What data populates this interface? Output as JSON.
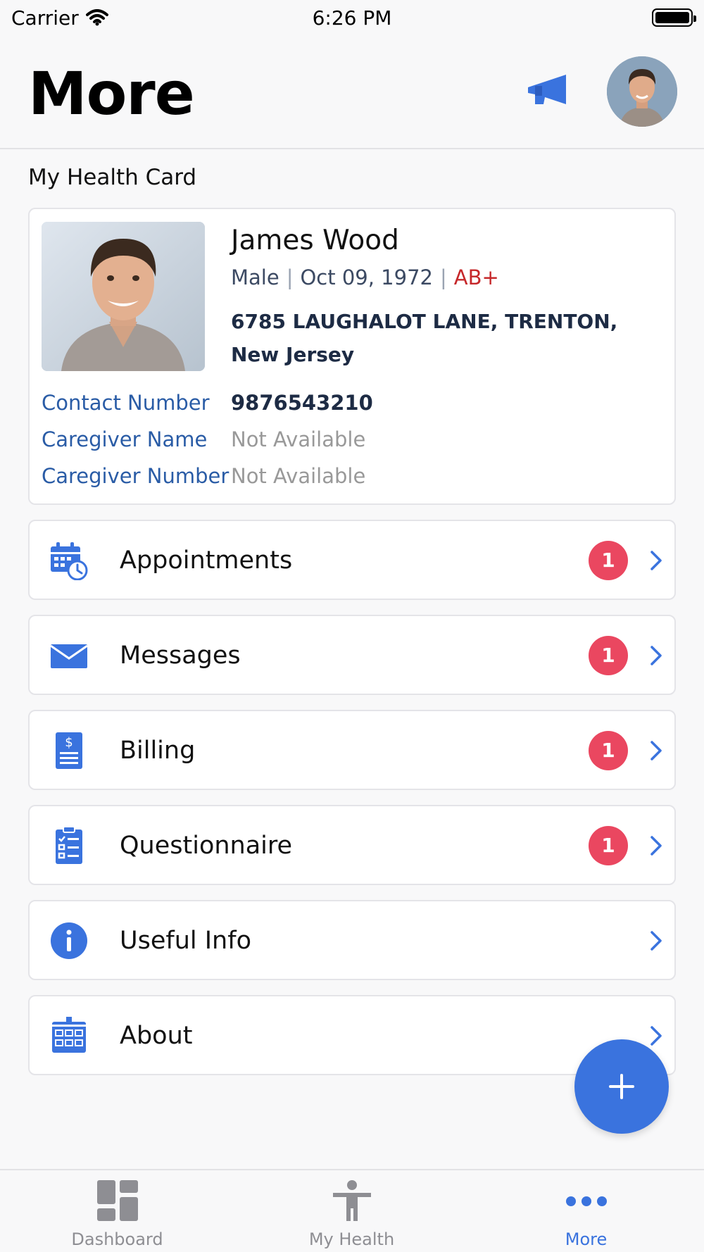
{
  "status_bar": {
    "carrier": "Carrier",
    "time": "6:26 PM"
  },
  "header": {
    "title": "More",
    "announcement_icon": "megaphone-icon",
    "avatar": "profile-avatar"
  },
  "health_card": {
    "section_label": "My Health Card",
    "name": "James Wood",
    "gender": "Male",
    "dob": "Oct 09, 1972",
    "blood_group": "AB+",
    "address": "6785 LAUGHALOT LANE, TRENTON, New Jersey",
    "fields": [
      {
        "label": "Contact Number",
        "value": "9876543210"
      },
      {
        "label": "Caregiver Name",
        "value": "Not Available"
      },
      {
        "label": "Caregiver Number",
        "value": "Not Available"
      }
    ]
  },
  "menu": [
    {
      "label": "Appointments",
      "badge": "1",
      "icon": "calendar-clock-icon"
    },
    {
      "label": "Messages",
      "badge": "1",
      "icon": "envelope-icon"
    },
    {
      "label": "Billing",
      "badge": "1",
      "icon": "bill-icon"
    },
    {
      "label": "Questionnaire",
      "badge": "1",
      "icon": "clipboard-checklist-icon"
    },
    {
      "label": "Useful Info",
      "badge": "",
      "icon": "info-icon"
    },
    {
      "label": "About",
      "badge": "",
      "icon": "building-icon"
    }
  ],
  "tab_bar": {
    "tabs": [
      {
        "label": "Dashboard",
        "icon": "dashboard-icon",
        "active": false
      },
      {
        "label": "My Health",
        "icon": "person-icon",
        "active": false
      },
      {
        "label": "More",
        "icon": "more-dots-icon",
        "active": true
      }
    ]
  },
  "colors": {
    "accent": "#3a73de",
    "badge": "#ea4760",
    "label_blue": "#2a5ca6",
    "blood_red": "#c6282b"
  }
}
